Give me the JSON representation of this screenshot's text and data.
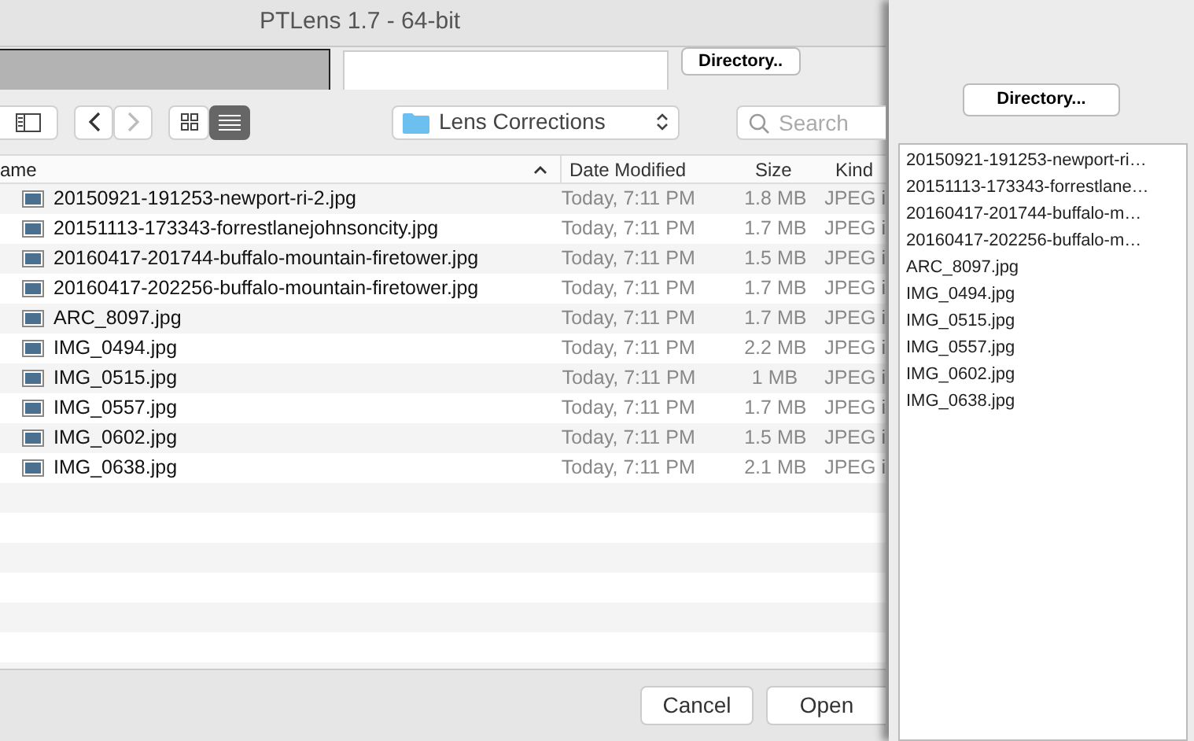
{
  "window": {
    "title": "PTLens 1.7 - 64-bit",
    "directory_button": "Directory.."
  },
  "dialog": {
    "toolbar": {
      "views": [
        {
          "kind": "icons",
          "selected": false
        },
        {
          "kind": "list",
          "selected": true
        }
      ],
      "location": "Lens Corrections",
      "search": {
        "placeholder": "Search"
      }
    },
    "columns": [
      {
        "label": "ame",
        "sorted": true
      },
      {
        "label": "Date Modified",
        "sorted": false
      },
      {
        "label": "Size",
        "sorted": false
      },
      {
        "label": "Kind",
        "sorted": false
      }
    ],
    "rows": [
      {
        "name": "20150921-191253-newport-ri-2.jpg",
        "date": "Today, 7:11 PM",
        "size": "1.8 MB",
        "kind": "JPEG i"
      },
      {
        "name": "20151113-173343-forrestlanejohnsoncity.jpg",
        "date": "Today, 7:11 PM",
        "size": "1.7 MB",
        "kind": "JPEG i"
      },
      {
        "name": "20160417-201744-buffalo-mountain-firetower.jpg",
        "date": "Today, 7:11 PM",
        "size": "1.5 MB",
        "kind": "JPEG i"
      },
      {
        "name": "20160417-202256-buffalo-mountain-firetower.jpg",
        "date": "Today, 7:11 PM",
        "size": "1.7 MB",
        "kind": "JPEG i"
      },
      {
        "name": "ARC_8097.jpg",
        "date": "Today, 7:11 PM",
        "size": "1.7 MB",
        "kind": "JPEG i"
      },
      {
        "name": "IMG_0494.jpg",
        "date": "Today, 7:11 PM",
        "size": "2.2 MB",
        "kind": "JPEG i"
      },
      {
        "name": "IMG_0515.jpg",
        "date": "Today, 7:11 PM",
        "size": "1 MB",
        "kind": "JPEG i"
      },
      {
        "name": "IMG_0557.jpg",
        "date": "Today, 7:11 PM",
        "size": "1.7 MB",
        "kind": "JPEG i"
      },
      {
        "name": "IMG_0602.jpg",
        "date": "Today, 7:11 PM",
        "size": "1.5 MB",
        "kind": "JPEG i"
      },
      {
        "name": "IMG_0638.jpg",
        "date": "Today, 7:11 PM",
        "size": "2.1 MB",
        "kind": "JPEG i"
      }
    ],
    "buttons": [
      "Cancel",
      "Open"
    ]
  },
  "side_panel": {
    "directory_button": "Directory...",
    "files": [
      "20150921-191253-newport-ri…",
      "20151113-173343-forrestlane…",
      "20160417-201744-buffalo-m…",
      "20160417-202256-buffalo-m…",
      "ARC_8097.jpg",
      "IMG_0494.jpg",
      "IMG_0515.jpg",
      "IMG_0557.jpg",
      "IMG_0602.jpg",
      "IMG_0638.jpg"
    ]
  }
}
